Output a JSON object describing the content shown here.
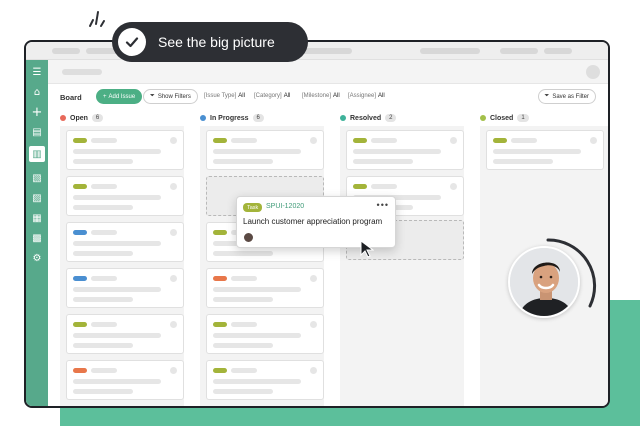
{
  "banner": {
    "text": "See  the big picture"
  },
  "toolbar": {
    "board_title": "Board",
    "add_issue_label": "Add Issue",
    "show_filters_label": "Show Filters",
    "save_filter_label": "Save as Filter",
    "filters": [
      {
        "label": "[Issue Type]",
        "value": "All"
      },
      {
        "label": "[Category]",
        "value": "All"
      },
      {
        "label": "[Milestone]",
        "value": "All"
      },
      {
        "label": "[Assignee]",
        "value": "All"
      }
    ]
  },
  "columns": [
    {
      "name": "Open",
      "count": "6",
      "color": "#e8695a"
    },
    {
      "name": "In Progress",
      "count": "6",
      "color": "#4a8fd1"
    },
    {
      "name": "Resolved",
      "count": "2",
      "color": "#3fb29a"
    },
    {
      "name": "Closed",
      "count": "1",
      "color": "#a3c04a"
    }
  ],
  "tag_colors": {
    "green": "#a3b43a",
    "blue": "#4a8fd1",
    "orange": "#e8774a"
  },
  "popup": {
    "type": "Task",
    "key": "SPUI-12020",
    "title": "Launch customer appreciation program",
    "more": "•••"
  },
  "sidebar_icons": [
    "menu-icon",
    "home-icon",
    "add-icon",
    "list-icon",
    "board-icon",
    "document-icon",
    "file-icon",
    "wiki-icon",
    "git-icon",
    "settings-icon"
  ],
  "accent": "#57a98b"
}
